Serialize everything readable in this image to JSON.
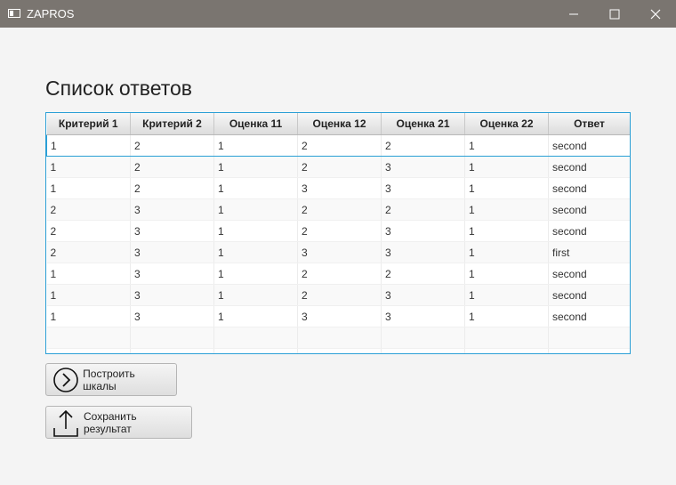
{
  "window": {
    "title": "ZAPROS"
  },
  "heading": "Список ответов",
  "table": {
    "columns": [
      "Критерий 1",
      "Критерий 2",
      "Оценка 11",
      "Оценка 12",
      "Оценка 21",
      "Оценка 22",
      "Ответ"
    ],
    "rows": [
      [
        "1",
        "2",
        "1",
        "2",
        "2",
        "1",
        "second"
      ],
      [
        "1",
        "2",
        "1",
        "2",
        "3",
        "1",
        "second"
      ],
      [
        "1",
        "2",
        "1",
        "3",
        "3",
        "1",
        "second"
      ],
      [
        "2",
        "3",
        "1",
        "2",
        "2",
        "1",
        "second"
      ],
      [
        "2",
        "3",
        "1",
        "2",
        "3",
        "1",
        "second"
      ],
      [
        "2",
        "3",
        "1",
        "3",
        "3",
        "1",
        "first"
      ],
      [
        "1",
        "3",
        "1",
        "2",
        "2",
        "1",
        "second"
      ],
      [
        "1",
        "3",
        "1",
        "2",
        "3",
        "1",
        "second"
      ],
      [
        "1",
        "3",
        "1",
        "3",
        "3",
        "1",
        "second"
      ]
    ]
  },
  "buttons": {
    "build_scales": "Построить шкалы",
    "save_result": "Сохранить результат"
  }
}
